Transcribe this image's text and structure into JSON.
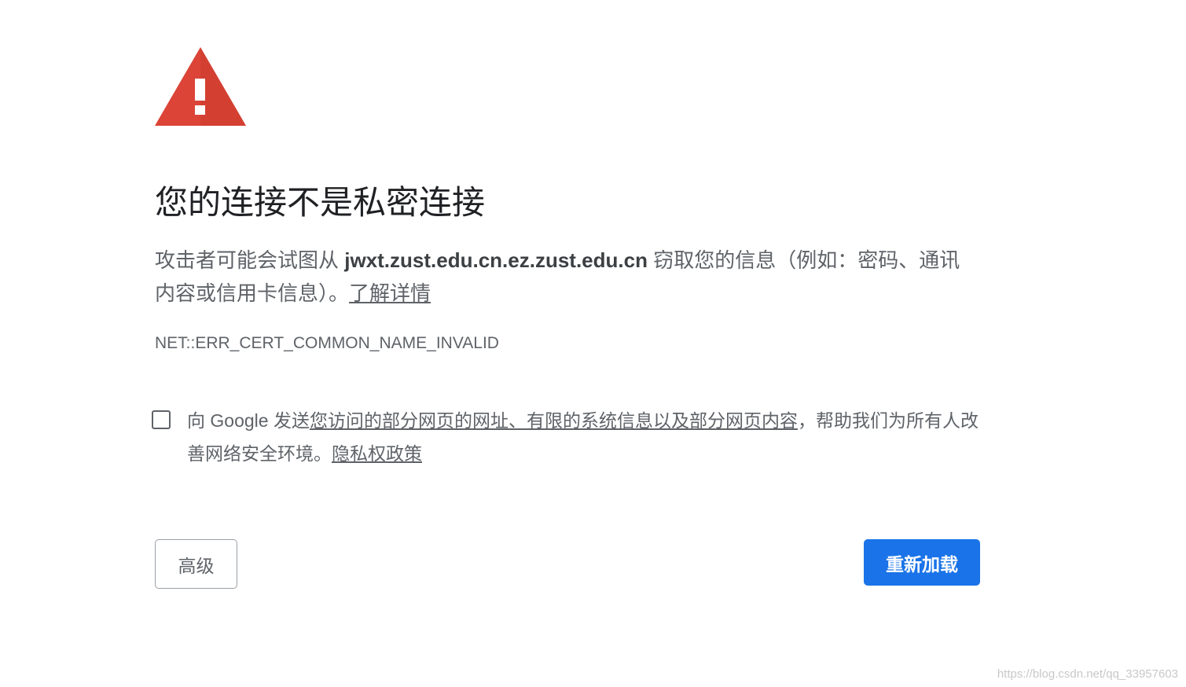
{
  "title": "您的连接不是私密连接",
  "explanation": {
    "before_host": "攻击者可能会试图从 ",
    "host": "jwxt.zust.edu.cn.ez.zust.edu.cn",
    "after_host": " 窃取您的信息（例如：密码、通讯内容或信用卡信息）。",
    "learn_more_link": "了解详情"
  },
  "error_code": "NET::ERR_CERT_COMMON_NAME_INVALID",
  "optin": {
    "checked": false,
    "prefix": "向 Google 发送",
    "data_link": "您访问的部分网页的网址、有限的系统信息以及部分网页内容",
    "middle": "，帮助我们为所有人改善网络安全环境。",
    "privacy_link": "隐私权政策"
  },
  "buttons": {
    "advanced_label": "高级",
    "reload_label": "重新加载"
  },
  "watermark": "https://blog.csdn.net/qq_33957603",
  "colors": {
    "warning_red": "#db4437",
    "primary_blue": "#1a73e8",
    "title_text": "#202124",
    "body_text": "#5f6368"
  },
  "icons": {
    "warning": "warning-triangle-icon"
  }
}
